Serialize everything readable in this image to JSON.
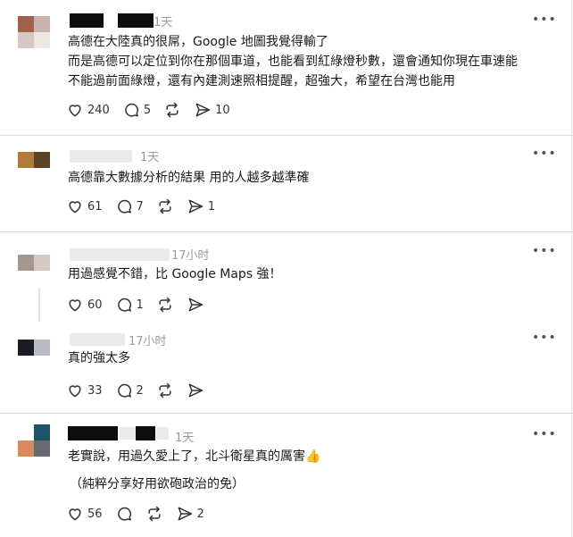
{
  "posts": [
    {
      "time": "1天",
      "text": [
        "高德在大陸真的很屌，Google 地圖我覺得輸了",
        "而是高德可以定位到你在那個車道，也能看到紅綠燈秒數，還會通知你現在車速能",
        "不能過前面綠燈，還有內建測速照相提醒，超強大，希望在台灣也能用"
      ],
      "likes": "240",
      "comments": "5",
      "reposts": "",
      "shares": "10"
    },
    {
      "time": "1天",
      "text": [
        "高德靠大數據分析的結果 用的人越多越準確"
      ],
      "likes": "61",
      "comments": "7",
      "reposts": "",
      "shares": "1"
    },
    {
      "time": "17小时",
      "text": [
        "用過感覺不錯，比 Google Maps 強！"
      ],
      "likes": "60",
      "comments": "1",
      "reposts": "",
      "shares": ""
    },
    {
      "time": "17小时",
      "text": [
        "真的強太多"
      ],
      "likes": "33",
      "comments": "2",
      "reposts": "",
      "shares": ""
    },
    {
      "time": "1天",
      "text": [
        "老實說，用過久愛上了，北斗衛星真的厲害👍",
        "（純粹分享好用欲砲政治的免）"
      ],
      "likes": "56",
      "comments": "",
      "reposts": "",
      "shares": "2"
    }
  ],
  "icons": {
    "like": "heart-icon",
    "comment": "comment-icon",
    "repost": "repost-icon",
    "share": "share-icon",
    "more": "more-icon"
  },
  "more_glyph": "•••"
}
